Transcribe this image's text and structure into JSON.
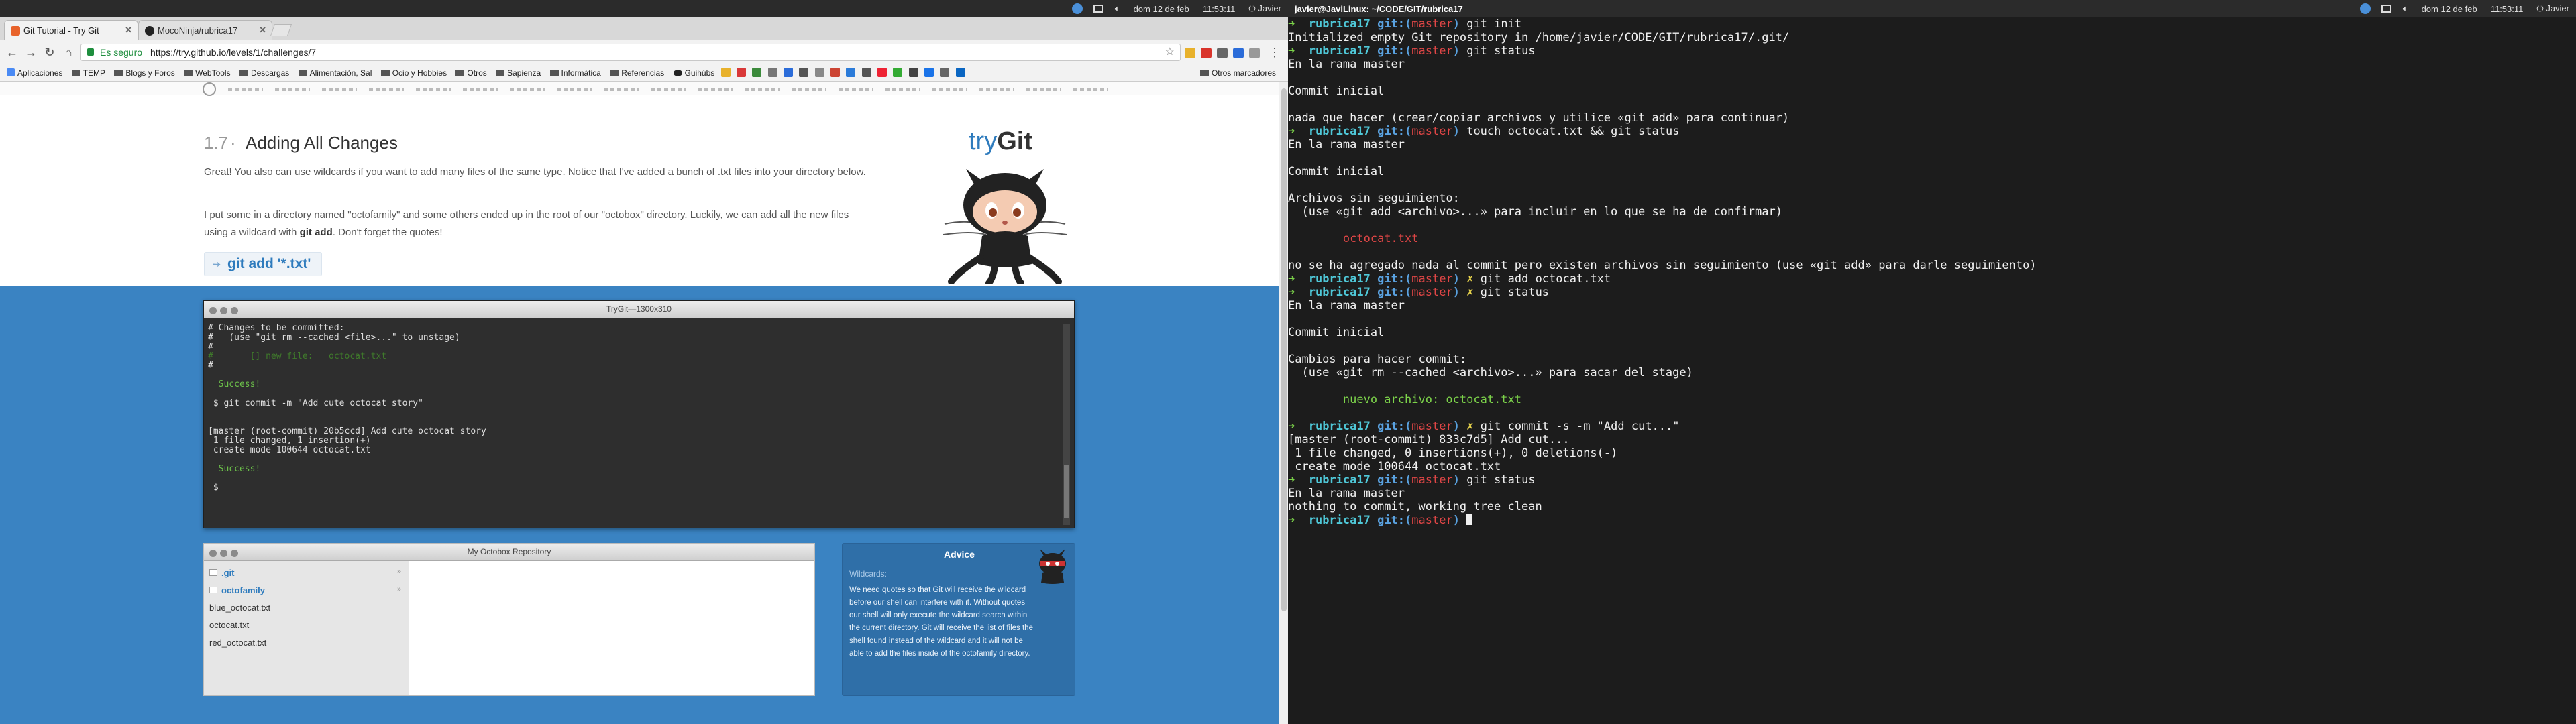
{
  "topbar_left": {
    "date": "dom 12 de feb",
    "time": "11:53:11",
    "user": "Javier"
  },
  "topbar_right": {
    "title": "javier@JaviLinux: ~/CODE/GIT/rubrica17",
    "date": "dom 12 de feb",
    "time": "11:53:11",
    "user": "Javier"
  },
  "browser": {
    "tabs": [
      {
        "label": "Git Tutorial - Try Git",
        "active": true
      },
      {
        "label": "MocoNinja/rubrica17",
        "active": false
      }
    ],
    "secure_label": "Es seguro",
    "url": "https://try.github.io/levels/1/challenges/7",
    "bookmarks": [
      "Aplicaciones",
      "TEMP",
      "Blogs y Foros",
      "WebTools",
      "Descargas",
      "Alimentación, Sal",
      "Ocio y Hobbies",
      "Otros",
      "Sapienza",
      "Informática",
      "Referencias",
      "Guihúbs"
    ],
    "other_bookmarks": "Otros marcadores"
  },
  "lesson": {
    "number": "1.7",
    "separator": "·",
    "title": "Adding All Changes",
    "paragraph1": "Great! You also can use wildcards if you want to add many files of the same type. Notice that I've added a bunch of .txt files into your directory below.",
    "paragraph2_a": "I put some in a directory named \"octofamily\" and some others ended up in the root of our \"octobox\" directory. Luckily, we can add all the new files using a wildcard with ",
    "paragraph2_cmd": "git add",
    "paragraph2_b": ". Don't forget the quotes!",
    "hint": "git add '*.txt'",
    "logo_try": "try",
    "logo_git": "Git"
  },
  "term_window": {
    "title": "TryGit—1300x310",
    "lines": [
      "# Changes to be committed:",
      "#   (use \"git rm --cached <file>...\" to unstage)",
      "#",
      "#       [] new file:   octocat.txt",
      "#",
      "",
      "  Success!",
      "",
      " $ git commit -m \"Add cute octocat story\"",
      "",
      "",
      "[master (root-commit) 20b5ccd] Add cute octocat story",
      " 1 file changed, 1 insertion(+)",
      " create mode 100644 octocat.txt",
      "",
      "  Success!",
      "",
      " $"
    ]
  },
  "repo_window": {
    "title": "My Octobox Repository",
    "items": [
      ".git",
      "octofamily",
      "blue_octocat.txt",
      "octocat.txt",
      "red_octocat.txt"
    ]
  },
  "advice": {
    "title": "Advice",
    "subtitle": "Wildcards:",
    "text": "We need quotes so that Git will receive the wildcard before our shell can interfere with it. Without quotes our shell will only execute the wildcard search within the current directory. Git will receive the list of files the shell found instead of the wildcard and it will not be able to add the files inside of the octofamily directory."
  },
  "right_terminal": {
    "prompt_dir": "rubrica17",
    "git_label": "git:(",
    "branch": "master",
    "git_close": ")",
    "lines": [
      {
        "type": "cmd",
        "dirty": false,
        "text": "git init"
      },
      {
        "type": "out",
        "text": "Initialized empty Git repository in /home/javier/CODE/GIT/rubrica17/.git/"
      },
      {
        "type": "cmd",
        "dirty": false,
        "text": "git status"
      },
      {
        "type": "out",
        "text": "En la rama master"
      },
      {
        "type": "out",
        "text": ""
      },
      {
        "type": "out",
        "text": "Commit inicial"
      },
      {
        "type": "out",
        "text": ""
      },
      {
        "type": "out",
        "text": "nada que hacer (crear/copiar archivos y utilice «git add» para continuar)"
      },
      {
        "type": "cmd",
        "dirty": false,
        "text": "touch octocat.txt && git status"
      },
      {
        "type": "out",
        "text": "En la rama master"
      },
      {
        "type": "out",
        "text": ""
      },
      {
        "type": "out",
        "text": "Commit inicial"
      },
      {
        "type": "out",
        "text": ""
      },
      {
        "type": "out",
        "text": "Archivos sin seguimiento:"
      },
      {
        "type": "out",
        "text": "  (use «git add <archivo>...» para incluir en lo que se ha de confirmar)"
      },
      {
        "type": "out",
        "text": ""
      },
      {
        "type": "red",
        "text": "\toctocat.txt"
      },
      {
        "type": "out",
        "text": ""
      },
      {
        "type": "out",
        "text": "no se ha agregado nada al commit pero existen archivos sin seguimiento (use «git add» para darle seguimiento)"
      },
      {
        "type": "cmd",
        "dirty": true,
        "text": "git add octocat.txt"
      },
      {
        "type": "cmd",
        "dirty": true,
        "text": "git status"
      },
      {
        "type": "out",
        "text": "En la rama master"
      },
      {
        "type": "out",
        "text": ""
      },
      {
        "type": "out",
        "text": "Commit inicial"
      },
      {
        "type": "out",
        "text": ""
      },
      {
        "type": "out",
        "text": "Cambios para hacer commit:"
      },
      {
        "type": "out",
        "text": "  (use «git rm --cached <archivo>...» para sacar del stage)"
      },
      {
        "type": "out",
        "text": ""
      },
      {
        "type": "green",
        "text": "\tnuevo archivo: octocat.txt"
      },
      {
        "type": "out",
        "text": ""
      },
      {
        "type": "cmd",
        "dirty": true,
        "text": "git commit -s -m \"Add cut...\""
      },
      {
        "type": "out",
        "text": "[master (root-commit) 833c7d5] Add cut..."
      },
      {
        "type": "out",
        "text": " 1 file changed, 0 insertions(+), 0 deletions(-)"
      },
      {
        "type": "out",
        "text": " create mode 100644 octocat.txt"
      },
      {
        "type": "cmd",
        "dirty": false,
        "text": "git status"
      },
      {
        "type": "out",
        "text": "En la rama master"
      },
      {
        "type": "out",
        "text": "nothing to commit, working tree clean"
      },
      {
        "type": "cmd_cursor",
        "dirty": false,
        "text": ""
      }
    ]
  },
  "icons": {
    "dirty_marker": "✗",
    "prompt_arrow": "➜"
  }
}
